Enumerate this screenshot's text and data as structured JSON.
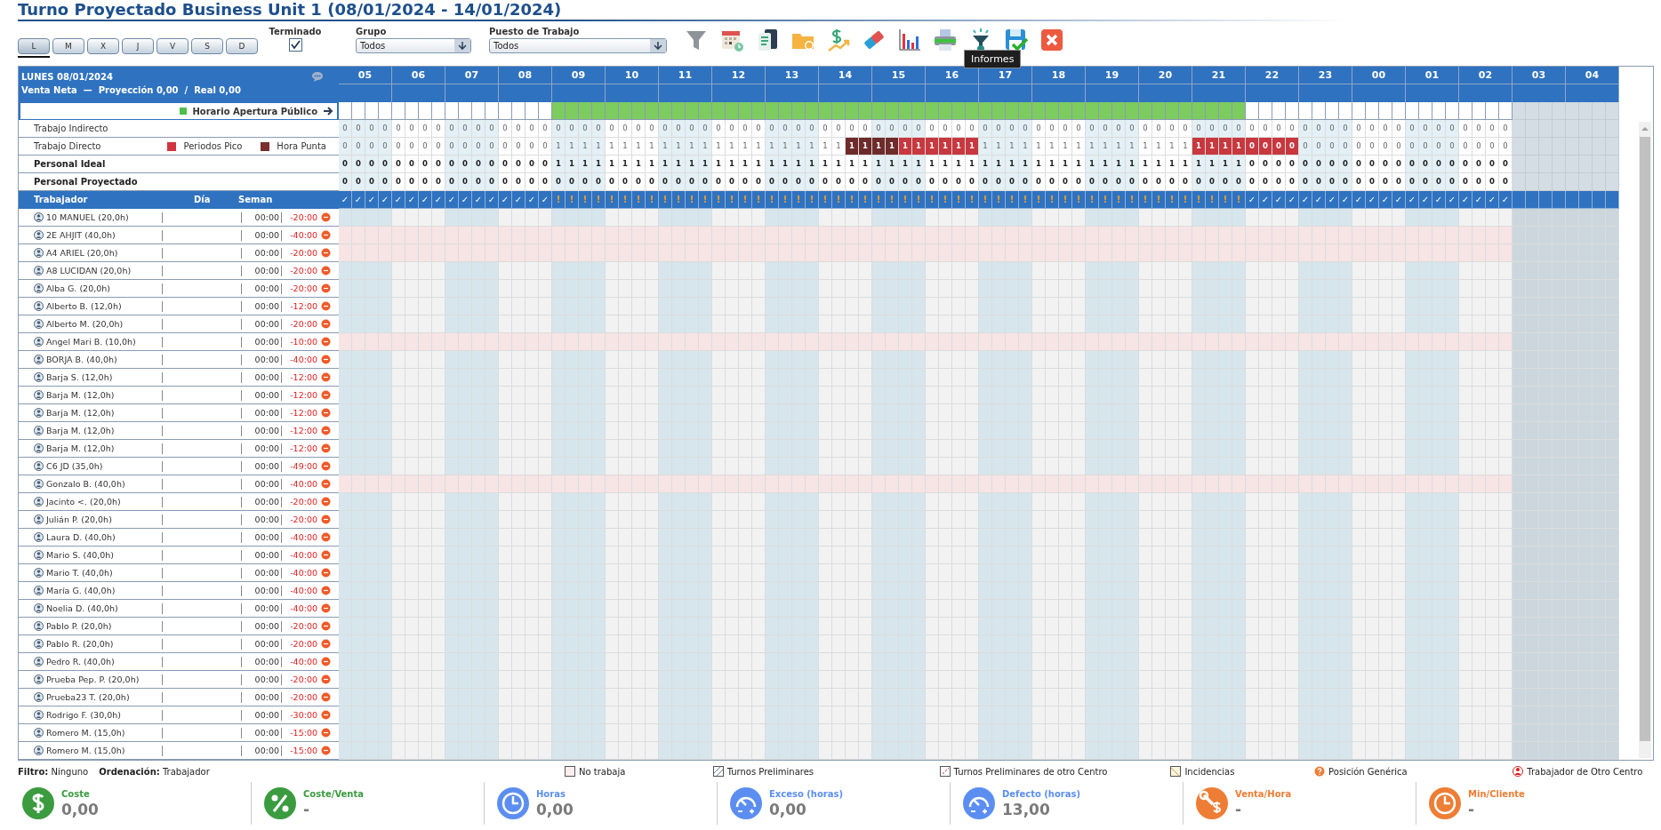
{
  "title": "Turno Proyectado Business Unit 1 (08/01/2024 - 14/01/2024)",
  "day_tabs": [
    {
      "label": "L",
      "selected": true
    },
    {
      "label": "M",
      "selected": false
    },
    {
      "label": "X",
      "selected": false
    },
    {
      "label": "J",
      "selected": false
    },
    {
      "label": "V",
      "selected": false
    },
    {
      "label": "S",
      "selected": false
    },
    {
      "label": "D",
      "selected": false
    }
  ],
  "finished": {
    "label": "Terminado",
    "checked": true
  },
  "filters": [
    {
      "label": "Grupo",
      "value": "Todos"
    },
    {
      "label": "Puesto de Trabajo",
      "value": "Todos"
    }
  ],
  "tooltip": "Informes",
  "grid": {
    "date": "LUNES 08/01/2024",
    "sales": "Venta Neta  —  Proyección 0,00  /  Real 0,00",
    "opening_label": "Horario Apertura Público",
    "hours": [
      {
        "label": "05",
        "disabled": false,
        "open": [
          false,
          false,
          false,
          false
        ],
        "marks": [
          "✓",
          "✓",
          "✓",
          "✓"
        ]
      },
      {
        "label": "06",
        "disabled": false,
        "open": [
          false,
          false,
          false,
          false
        ],
        "marks": [
          "✓",
          "✓",
          "✓",
          "✓"
        ]
      },
      {
        "label": "07",
        "disabled": false,
        "open": [
          false,
          false,
          false,
          false
        ],
        "marks": [
          "✓",
          "✓",
          "✓",
          "✓"
        ]
      },
      {
        "label": "08",
        "disabled": false,
        "open": [
          false,
          false,
          false,
          false
        ],
        "marks": [
          "✓",
          "✓",
          "✓",
          "✓"
        ]
      },
      {
        "label": "09",
        "disabled": false,
        "open": [
          true,
          true,
          true,
          true
        ],
        "marks": [
          "!",
          "!",
          "!",
          "!"
        ]
      },
      {
        "label": "10",
        "disabled": false,
        "open": [
          true,
          true,
          true,
          true
        ],
        "marks": [
          "!",
          "!",
          "!",
          "!"
        ]
      },
      {
        "label": "11",
        "disabled": false,
        "open": [
          true,
          true,
          true,
          true
        ],
        "marks": [
          "!",
          "!",
          "!",
          "!"
        ]
      },
      {
        "label": "12",
        "disabled": false,
        "open": [
          true,
          true,
          true,
          true
        ],
        "marks": [
          "!",
          "!",
          "!",
          "!"
        ]
      },
      {
        "label": "13",
        "disabled": false,
        "open": [
          true,
          true,
          true,
          true
        ],
        "marks": [
          "!",
          "!",
          "!",
          "!"
        ]
      },
      {
        "label": "14",
        "disabled": false,
        "open": [
          true,
          true,
          true,
          true
        ],
        "marks": [
          "!",
          "!",
          "!",
          "!"
        ]
      },
      {
        "label": "15",
        "disabled": false,
        "open": [
          true,
          true,
          true,
          true
        ],
        "marks": [
          "!",
          "!",
          "!",
          "!"
        ]
      },
      {
        "label": "16",
        "disabled": false,
        "open": [
          true,
          true,
          true,
          true
        ],
        "marks": [
          "!",
          "!",
          "!",
          "!"
        ]
      },
      {
        "label": "17",
        "disabled": false,
        "open": [
          true,
          true,
          true,
          true
        ],
        "marks": [
          "!",
          "!",
          "!",
          "!"
        ]
      },
      {
        "label": "18",
        "disabled": false,
        "open": [
          true,
          true,
          true,
          true
        ],
        "marks": [
          "!",
          "!",
          "!",
          "!"
        ]
      },
      {
        "label": "19",
        "disabled": false,
        "open": [
          true,
          true,
          true,
          true
        ],
        "marks": [
          "!",
          "!",
          "!",
          "!"
        ]
      },
      {
        "label": "20",
        "disabled": false,
        "open": [
          true,
          true,
          true,
          true
        ],
        "marks": [
          "!",
          "!",
          "!",
          "!"
        ]
      },
      {
        "label": "21",
        "disabled": false,
        "open": [
          true,
          true,
          true,
          true
        ],
        "marks": [
          "!",
          "!",
          "!",
          "!"
        ]
      },
      {
        "label": "22",
        "disabled": false,
        "open": [
          false,
          false,
          false,
          false
        ],
        "marks": [
          "✓",
          "✓",
          "✓",
          "✓"
        ]
      },
      {
        "label": "23",
        "disabled": false,
        "open": [
          false,
          false,
          false,
          false
        ],
        "marks": [
          "✓",
          "✓",
          "✓",
          "✓"
        ]
      },
      {
        "label": "00",
        "disabled": false,
        "open": [
          false,
          false,
          false,
          false
        ],
        "marks": [
          "✓",
          "✓",
          "✓",
          "✓"
        ]
      },
      {
        "label": "01",
        "disabled": false,
        "open": [
          false,
          false,
          false,
          false
        ],
        "marks": [
          "✓",
          "✓",
          "✓",
          "✓"
        ]
      },
      {
        "label": "02",
        "disabled": false,
        "open": [
          false,
          false,
          false,
          false
        ],
        "marks": [
          "✓",
          "✓",
          "✓",
          "✓"
        ]
      },
      {
        "label": "03",
        "disabled": true
      },
      {
        "label": "04",
        "disabled": true
      }
    ],
    "metrics": [
      {
        "label": "Trabajo Indirecto",
        "kind": "detail",
        "values": [
          [
            "0",
            "0",
            "0",
            "0"
          ],
          [
            "0",
            "0",
            "0",
            "0"
          ],
          [
            "0",
            "0",
            "0",
            "0"
          ],
          [
            "0",
            "0",
            "0",
            "0"
          ],
          [
            "0",
            "0",
            "0",
            "0"
          ],
          [
            "0",
            "0",
            "0",
            "0"
          ],
          [
            "0",
            "0",
            "0",
            "0"
          ],
          [
            "0",
            "0",
            "0",
            "0"
          ],
          [
            "0",
            "0",
            "0",
            "0"
          ],
          [
            "0",
            "0",
            "0",
            "0"
          ],
          [
            "0",
            "0",
            "0",
            "0"
          ],
          [
            "0",
            "0",
            "0",
            "0"
          ],
          [
            "0",
            "0",
            "0",
            "0"
          ],
          [
            "0",
            "0",
            "0",
            "0"
          ],
          [
            "0",
            "0",
            "0",
            "0"
          ],
          [
            "0",
            "0",
            "0",
            "0"
          ],
          [
            "0",
            "0",
            "0",
            "0"
          ],
          [
            "0",
            "0",
            "0",
            "0"
          ],
          [
            "0",
            "0",
            "0",
            "0"
          ],
          [
            "0",
            "0",
            "0",
            "0"
          ],
          [
            "0",
            "0",
            "0",
            "0"
          ],
          [
            "0",
            "0",
            "0",
            "0"
          ]
        ]
      },
      {
        "label": "Trabajo Directo",
        "kind": "detail",
        "legend": [
          {
            "label": "Periodos Pico",
            "color": "#d2353e"
          },
          {
            "label": "Hora Punta",
            "color": "#7a2e2e"
          }
        ],
        "values": [
          [
            "0",
            "0",
            "0",
            "0"
          ],
          [
            "0",
            "0",
            "0",
            "0"
          ],
          [
            "0",
            "0",
            "0",
            "0"
          ],
          [
            "0",
            "0",
            "0",
            "0"
          ],
          [
            "1",
            "1",
            "1",
            "1"
          ],
          [
            "1",
            "1",
            "1",
            "1"
          ],
          [
            "1",
            "1",
            "1",
            "1"
          ],
          [
            "1",
            "1",
            "1",
            "1"
          ],
          [
            "1",
            "1",
            "1",
            "1"
          ],
          [
            "1",
            "1",
            "1",
            "1"
          ],
          [
            "1",
            "1",
            "1",
            "1"
          ],
          [
            "1",
            "1",
            "1",
            "1"
          ],
          [
            "1",
            "1",
            "1",
            "1"
          ],
          [
            "1",
            "1",
            "1",
            "1"
          ],
          [
            "1",
            "1",
            "1",
            "1"
          ],
          [
            "1",
            "1",
            "1",
            "1"
          ],
          [
            "1",
            "1",
            "1",
            "1"
          ],
          [
            "0",
            "0",
            "0",
            "0"
          ],
          [
            "0",
            "0",
            "0",
            "0"
          ],
          [
            "0",
            "0",
            "0",
            "0"
          ],
          [
            "0",
            "0",
            "0",
            "0"
          ],
          [
            "0",
            "0",
            "0",
            "0"
          ]
        ],
        "peak": [
          [
            false,
            false,
            false,
            false
          ],
          [
            false,
            false,
            false,
            false
          ],
          [
            false,
            false,
            false,
            false
          ],
          [
            false,
            false,
            false,
            false
          ],
          [
            false,
            false,
            false,
            false
          ],
          [
            false,
            false,
            false,
            false
          ],
          [
            false,
            false,
            false,
            false
          ],
          [
            false,
            false,
            false,
            false
          ],
          [
            false,
            false,
            false,
            false
          ],
          [
            false,
            false,
            false,
            false
          ],
          [
            false,
            false,
            true,
            true
          ],
          [
            true,
            true,
            true,
            true
          ],
          [
            false,
            false,
            false,
            false
          ],
          [
            false,
            false,
            false,
            false
          ],
          [
            false,
            false,
            false,
            false
          ],
          [
            false,
            false,
            false,
            false
          ],
          [
            true,
            true,
            true,
            true
          ],
          [
            true,
            true,
            true,
            true
          ],
          [
            false,
            false,
            false,
            false
          ],
          [
            false,
            false,
            false,
            false
          ],
          [
            false,
            false,
            false,
            false
          ],
          [
            false,
            false,
            false,
            false
          ]
        ],
        "rush": [
          [
            false,
            false,
            false,
            false
          ],
          [
            false,
            false,
            false,
            false
          ],
          [
            false,
            false,
            false,
            false
          ],
          [
            false,
            false,
            false,
            false
          ],
          [
            false,
            false,
            false,
            false
          ],
          [
            false,
            false,
            false,
            false
          ],
          [
            false,
            false,
            false,
            false
          ],
          [
            false,
            false,
            false,
            false
          ],
          [
            false,
            false,
            false,
            false
          ],
          [
            false,
            false,
            true,
            true
          ],
          [
            true,
            true,
            false,
            false
          ],
          [
            false,
            false,
            false,
            false
          ],
          [
            false,
            false,
            false,
            false
          ],
          [
            false,
            false,
            false,
            false
          ],
          [
            false,
            false,
            false,
            false
          ],
          [
            false,
            false,
            false,
            false
          ],
          [
            false,
            false,
            false,
            false
          ],
          [
            false,
            false,
            false,
            false
          ],
          [
            false,
            false,
            false,
            false
          ],
          [
            false,
            false,
            false,
            false
          ],
          [
            false,
            false,
            false,
            false
          ],
          [
            false,
            false,
            false,
            false
          ]
        ]
      },
      {
        "label": "Personal Ideal",
        "kind": "total",
        "values": [
          [
            "0",
            "0",
            "0",
            "0"
          ],
          [
            "0",
            "0",
            "0",
            "0"
          ],
          [
            "0",
            "0",
            "0",
            "0"
          ],
          [
            "0",
            "0",
            "0",
            "0"
          ],
          [
            "1",
            "1",
            "1",
            "1"
          ],
          [
            "1",
            "1",
            "1",
            "1"
          ],
          [
            "1",
            "1",
            "1",
            "1"
          ],
          [
            "1",
            "1",
            "1",
            "1"
          ],
          [
            "1",
            "1",
            "1",
            "1"
          ],
          [
            "1",
            "1",
            "1",
            "1"
          ],
          [
            "1",
            "1",
            "1",
            "1"
          ],
          [
            "1",
            "1",
            "1",
            "1"
          ],
          [
            "1",
            "1",
            "1",
            "1"
          ],
          [
            "1",
            "1",
            "1",
            "1"
          ],
          [
            "1",
            "1",
            "1",
            "1"
          ],
          [
            "1",
            "1",
            "1",
            "1"
          ],
          [
            "1",
            "1",
            "1",
            "1"
          ],
          [
            "0",
            "0",
            "0",
            "0"
          ],
          [
            "0",
            "0",
            "0",
            "0"
          ],
          [
            "0",
            "0",
            "0",
            "0"
          ],
          [
            "0",
            "0",
            "0",
            "0"
          ],
          [
            "0",
            "0",
            "0",
            "0"
          ]
        ]
      },
      {
        "label": "Personal Proyectado",
        "kind": "total",
        "values": [
          [
            "0",
            "0",
            "0",
            "0"
          ],
          [
            "0",
            "0",
            "0",
            "0"
          ],
          [
            "0",
            "0",
            "0",
            "0"
          ],
          [
            "0",
            "0",
            "0",
            "0"
          ],
          [
            "0",
            "0",
            "0",
            "0"
          ],
          [
            "0",
            "0",
            "0",
            "0"
          ],
          [
            "0",
            "0",
            "0",
            "0"
          ],
          [
            "0",
            "0",
            "0",
            "0"
          ],
          [
            "0",
            "0",
            "0",
            "0"
          ],
          [
            "0",
            "0",
            "0",
            "0"
          ],
          [
            "0",
            "0",
            "0",
            "0"
          ],
          [
            "0",
            "0",
            "0",
            "0"
          ],
          [
            "0",
            "0",
            "0",
            "0"
          ],
          [
            "0",
            "0",
            "0",
            "0"
          ],
          [
            "0",
            "0",
            "0",
            "0"
          ],
          [
            "0",
            "0",
            "0",
            "0"
          ],
          [
            "0",
            "0",
            "0",
            "0"
          ],
          [
            "0",
            "0",
            "0",
            "0"
          ],
          [
            "0",
            "0",
            "0",
            "0"
          ],
          [
            "0",
            "0",
            "0",
            "0"
          ],
          [
            "0",
            "0",
            "0",
            "0"
          ],
          [
            "0",
            "0",
            "0",
            "0"
          ]
        ]
      }
    ],
    "columns": [
      "Trabajador",
      "Día",
      "Seman"
    ],
    "workers": [
      {
        "name": "10 MANUEL (20,0h)",
        "day": "00:00",
        "week": "-20:00",
        "off": false
      },
      {
        "name": "2E AHJIT (40,0h)",
        "day": "00:00",
        "week": "-40:00",
        "off": true
      },
      {
        "name": "A4 ARIEL (20,0h)",
        "day": "00:00",
        "week": "-20:00",
        "off": true
      },
      {
        "name": "A8 LUCIDAN (20,0h)",
        "day": "00:00",
        "week": "-20:00",
        "off": false
      },
      {
        "name": "Alba G. (20,0h)",
        "day": "00:00",
        "week": "-20:00",
        "off": false
      },
      {
        "name": "Alberto B. (12,0h)",
        "day": "00:00",
        "week": "-12:00",
        "off": false
      },
      {
        "name": "Alberto M. (20,0h)",
        "day": "00:00",
        "week": "-20:00",
        "off": false
      },
      {
        "name": "Angel Mari B. (10,0h)",
        "day": "00:00",
        "week": "-10:00",
        "off": true
      },
      {
        "name": "BORJA B. (40,0h)",
        "day": "00:00",
        "week": "-40:00",
        "off": false
      },
      {
        "name": "Barja S. (12,0h)",
        "day": "00:00",
        "week": "-12:00",
        "off": false
      },
      {
        "name": "Barja M. (12,0h)",
        "day": "00:00",
        "week": "-12:00",
        "off": false
      },
      {
        "name": "Barja M. (12,0h)",
        "day": "00:00",
        "week": "-12:00",
        "off": false
      },
      {
        "name": "Barja M. (12,0h)",
        "day": "00:00",
        "week": "-12:00",
        "off": false
      },
      {
        "name": "Barja M. (12,0h)",
        "day": "00:00",
        "week": "-12:00",
        "off": false
      },
      {
        "name": "C6 JD (35,0h)",
        "day": "00:00",
        "week": "-49:00",
        "off": false
      },
      {
        "name": "Gonzalo B. (40,0h)",
        "day": "00:00",
        "week": "-40:00",
        "off": true
      },
      {
        "name": "Jacinto <. (20,0h)",
        "day": "00:00",
        "week": "-20:00",
        "off": false
      },
      {
        "name": "Julián P. (20,0h)",
        "day": "00:00",
        "week": "-20:00",
        "off": false
      },
      {
        "name": "Laura D. (40,0h)",
        "day": "00:00",
        "week": "-40:00",
        "off": false
      },
      {
        "name": "Mario S. (40,0h)",
        "day": "00:00",
        "week": "-40:00",
        "off": false
      },
      {
        "name": "Mario T. (40,0h)",
        "day": "00:00",
        "week": "-40:00",
        "off": false
      },
      {
        "name": "María G. (40,0h)",
        "day": "00:00",
        "week": "-40:00",
        "off": false
      },
      {
        "name": "Noelia D. (40,0h)",
        "day": "00:00",
        "week": "-40:00",
        "off": false
      },
      {
        "name": "Pablo P. (20,0h)",
        "day": "00:00",
        "week": "-20:00",
        "off": false
      },
      {
        "name": "Pablo R. (20,0h)",
        "day": "00:00",
        "week": "-20:00",
        "off": false
      },
      {
        "name": "Pedro R. (40,0h)",
        "day": "00:00",
        "week": "-40:00",
        "off": false
      },
      {
        "name": "Prueba Pep. P. (20,0h)",
        "day": "00:00",
        "week": "-20:00",
        "off": false
      },
      {
        "name": "Prueba23 T. (20,0h)",
        "day": "00:00",
        "week": "-20:00",
        "off": false
      },
      {
        "name": "Rodrigo F. (30,0h)",
        "day": "00:00",
        "week": "-30:00",
        "off": false
      },
      {
        "name": "Romero M. (15,0h)",
        "day": "00:00",
        "week": "-15:00",
        "off": false
      },
      {
        "name": "Romero M. (15,0h)",
        "day": "00:00",
        "week": "-15:00",
        "off": false
      }
    ]
  },
  "footer": {
    "filter": "**Filtro:** Ninguno",
    "sort": "**Ordenación:** Trabajador",
    "legend": [
      {
        "kind": "empty",
        "label": "No trabaja"
      },
      {
        "kind": "hatched",
        "label": "Turnos Preliminares"
      },
      {
        "kind": "hatched_other",
        "label": "Turnos Preliminares de otro Centro"
      },
      {
        "kind": "incident",
        "label": "Incidencias"
      },
      {
        "kind": "generic",
        "label": "Posición Genérica"
      },
      {
        "kind": "other_center",
        "label": "Trabajador de Otro Centro"
      }
    ],
    "kpis": [
      {
        "kind": "dollar",
        "label": "Coste",
        "value": "0,00",
        "color": "#3a9b3f"
      },
      {
        "kind": "percent",
        "label": "Coste/Venta",
        "value": "-",
        "color": "#3a9b3f"
      },
      {
        "kind": "clock",
        "label": "Horas",
        "value": "0,00",
        "color": "#5b8ef0"
      },
      {
        "kind": "gauge",
        "label": "Exceso (horas)",
        "value": "0,00",
        "color": "#5b8ef0"
      },
      {
        "kind": "gauge",
        "label": "Defecto (horas)",
        "value": "13,00",
        "color": "#5b8ef0"
      },
      {
        "kind": "wrench",
        "label": "Venta/Hora",
        "value": "-",
        "color": "#ee7d35"
      },
      {
        "kind": "clock",
        "label": "Min/Cliente",
        "value": "-",
        "color": "#ee7d35"
      }
    ]
  }
}
